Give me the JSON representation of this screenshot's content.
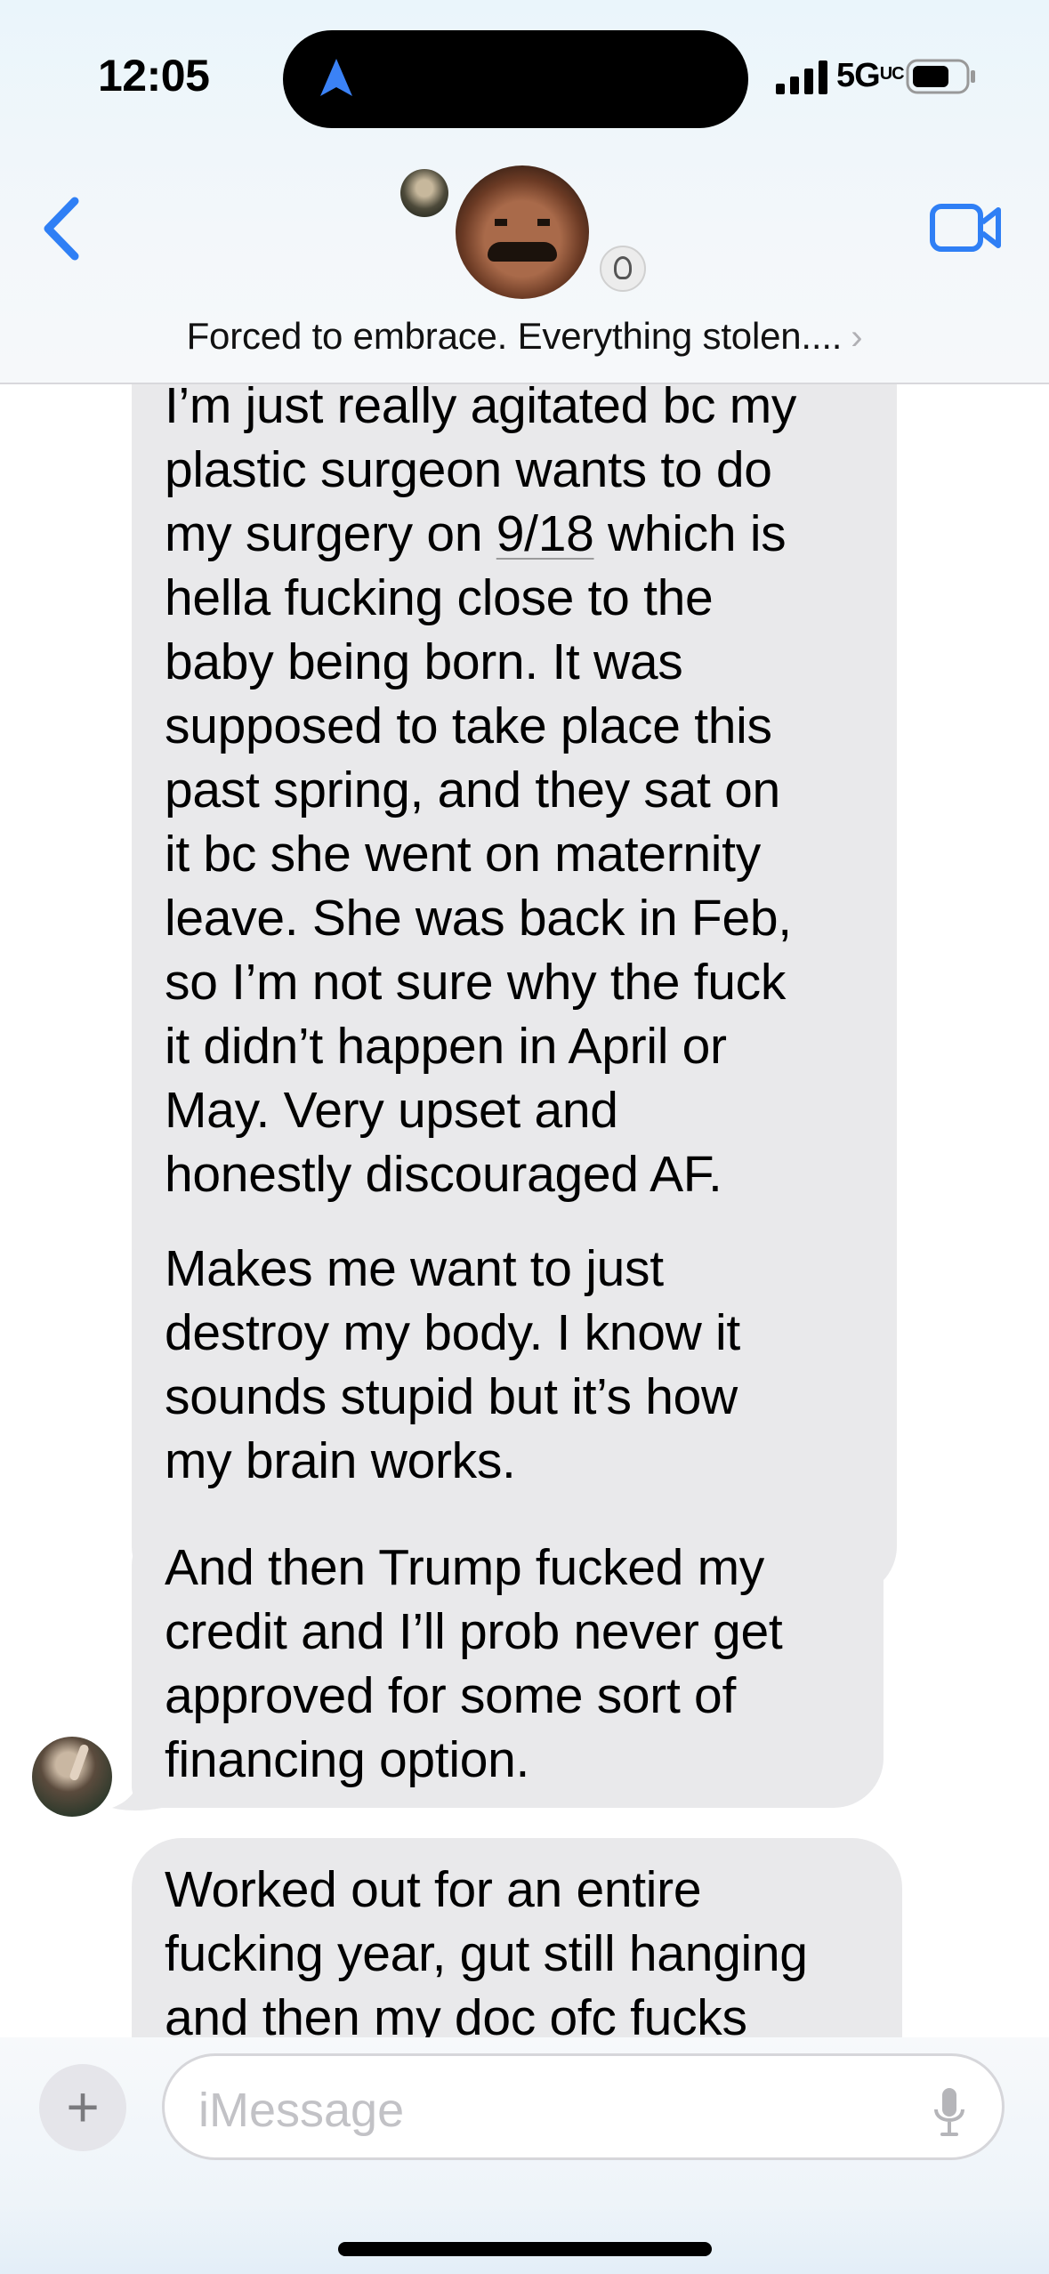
{
  "status_bar": {
    "time": "12:05",
    "network": "5G",
    "network_suffix": "UC"
  },
  "header": {
    "group_name": "Forced to embrace. Everything stolen....",
    "chevron": "›",
    "icons": [
      "back-chevron-icon",
      "video-camera-icon",
      "location-arrow-icon"
    ]
  },
  "messages": [
    {
      "lines": [
        "I’m just really agitated bc my",
        "plastic surgeon wants to do",
        "my surgery on 9/18 which is",
        "hella fucking close to the",
        "baby being born. It was",
        "supposed to take place this",
        "past spring, and they sat on",
        "it bc she went on maternity",
        "leave. She was back in Feb,",
        "so I’m not sure why the fuck",
        "it didn’t happen in April or",
        "May. Very upset and",
        "honestly discouraged AF."
      ],
      "line3_pre": "my surgery on ",
      "line3_link": "9/18",
      "line3_post": " which is"
    },
    {
      "lines": [
        "Makes me want to just",
        "destroy my body. I know it",
        "sounds stupid but it’s how",
        "my brain works."
      ]
    },
    {
      "lines": [
        "And then Trump fucked my",
        "credit and I’ll prob never get",
        "approved for some sort of",
        "financing option."
      ]
    },
    {
      "lines": [
        "Worked out for an entire",
        "fucking year, gut still hanging",
        "and then my doc ofc fucks"
      ]
    }
  ],
  "composer": {
    "plus_label": "+",
    "placeholder": "iMessage"
  },
  "colors": {
    "accent": "#2f7ff5",
    "bubble_received": "#e9e9eb"
  }
}
